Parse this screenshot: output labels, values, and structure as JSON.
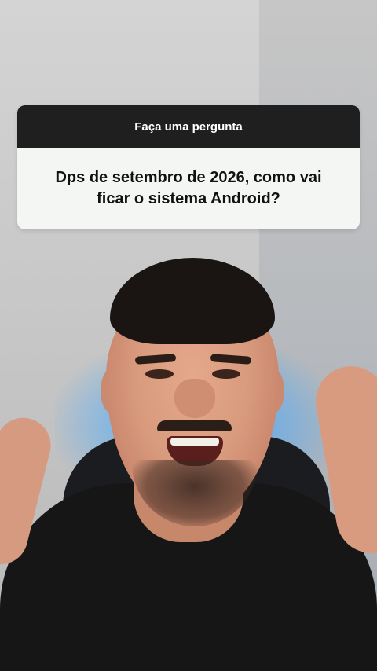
{
  "question_sticker": {
    "header_label": "Faça uma pergunta",
    "question_text": "Dps de setembro de 2026, como vai ficar o sistema Android?"
  },
  "colors": {
    "sticker_header_bg": "#1f1f1f",
    "sticker_body_bg": "#f4f6f4",
    "background_glow": "#3ca0ff"
  }
}
